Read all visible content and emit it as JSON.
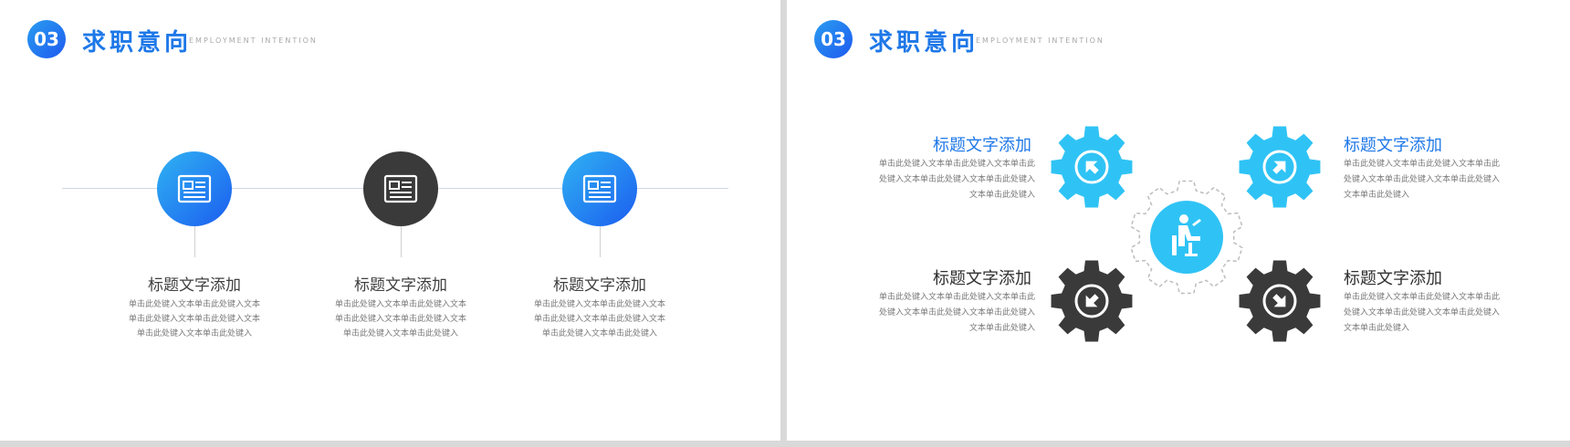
{
  "slides": [
    {
      "header": {
        "number": "03",
        "title": "求职意向",
        "subtitle": "EMPLOYMENT INTENTION"
      },
      "items": [
        {
          "title": "标题文字添加",
          "body": "单击此处键入文本单击此处键入文本单击此处键入文本单击此处键入文本单击此处键入文本单击此处键入"
        },
        {
          "title": "标题文字添加",
          "body": "单击此处键入文本单击此处键入文本单击此处键入文本单击此处键入文本单击此处键入文本单击此处键入"
        },
        {
          "title": "标题文字添加",
          "body": "单击此处键入文本单击此处键入文本单击此处键入文本单击此处键入文本单击此处键入文本单击此处键入"
        }
      ]
    },
    {
      "header": {
        "number": "03",
        "title": "求职意向",
        "subtitle": "EMPLOYMENT INTENTION"
      },
      "items": [
        {
          "title": "标题文字添加",
          "body": "单击此处键入文本单击此处键入文本单击此处键入文本单击此处键入文本单击此处键入文本单击此处键入"
        },
        {
          "title": "标题文字添加",
          "body": "单击此处键入文本单击此处键入文本单击此处键入文本单击此处键入文本单击此处键入文本单击此处键入"
        },
        {
          "title": "标题文字添加",
          "body": "单击此处键入文本单击此处键入文本单击此处键入文本单击此处键入文本单击此处键入文本单击此处键入"
        },
        {
          "title": "标题文字添加",
          "body": "单击此处键入文本单击此处键入文本单击此处键入文本单击此处键入文本单击此处键入文本单击此处键入"
        }
      ]
    }
  ],
  "colors": {
    "accent_blue": "#1e78e8",
    "gear_cyan": "#2fc3f5",
    "dark_gray": "#3a3a3a"
  },
  "icons": {
    "timeline_icon": "document-icon",
    "center_icon": "person-at-desk-icon"
  }
}
